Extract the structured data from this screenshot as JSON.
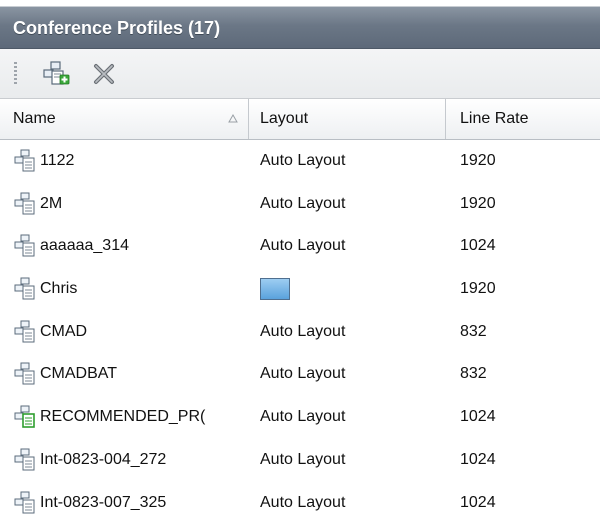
{
  "panel": {
    "title": "Conference Profiles (17)"
  },
  "toolbar": {
    "buttons": [
      {
        "icon": "add-profile-icon"
      },
      {
        "icon": "delete-icon"
      }
    ]
  },
  "table": {
    "columns": [
      {
        "label": "Name",
        "sorted": "ascending"
      },
      {
        "label": "Layout"
      },
      {
        "label": "Line Rate"
      }
    ],
    "rows": [
      {
        "name": "1122",
        "layout": "Auto Layout",
        "line_rate": "1920",
        "icon": "profile-icon"
      },
      {
        "name": "2M",
        "layout": "Auto Layout",
        "line_rate": "1920",
        "icon": "profile-icon"
      },
      {
        "name": "aaaaaa_314",
        "layout": "Auto Layout",
        "line_rate": "1024",
        "icon": "profile-icon"
      },
      {
        "name": "Chris",
        "layout": "",
        "layout_icon": "layout-thumbnail-icon",
        "line_rate": "1920",
        "icon": "profile-icon"
      },
      {
        "name": "CMAD",
        "layout": "Auto Layout",
        "line_rate": "832",
        "icon": "profile-icon"
      },
      {
        "name": "CMADBAT",
        "layout": "Auto Layout",
        "line_rate": "832",
        "icon": "profile-icon"
      },
      {
        "name": "RECOMMENDED_PR(",
        "layout": "Auto Layout",
        "line_rate": "1024",
        "icon": "recommended-profile-icon"
      },
      {
        "name": "Int-0823-004_272",
        "layout": "Auto Layout",
        "line_rate": "1024",
        "icon": "profile-icon"
      },
      {
        "name": "Int-0823-007_325",
        "layout": "Auto Layout",
        "line_rate": "1024",
        "icon": "profile-icon"
      }
    ]
  },
  "colors": {
    "title_bar": "#6b7786",
    "title_text": "#ffffff",
    "recommended_accent": "#2f9e2f",
    "layout_thumb": "#5aa2dc"
  }
}
